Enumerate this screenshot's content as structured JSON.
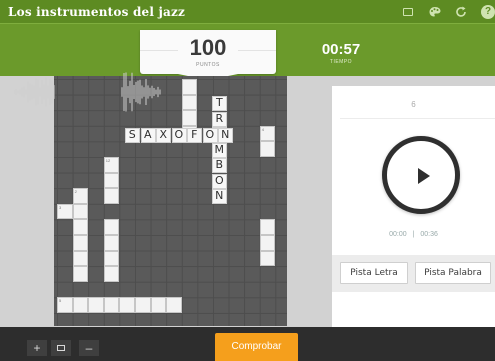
{
  "header": {
    "title": "Los instrumentos del jazz",
    "tools": [
      {
        "name": "keyboard-icon"
      },
      {
        "name": "palette-icon"
      },
      {
        "name": "refresh-icon"
      },
      {
        "name": "help-icon",
        "glyph": "?"
      }
    ]
  },
  "score": {
    "value": "100",
    "label": "PUNTOS"
  },
  "timer": {
    "value": "00:57",
    "label": "TIEMPO"
  },
  "board": {
    "words": [
      {
        "word": "TROMBON",
        "direction": "down"
      },
      {
        "word": "SAXOFON",
        "direction": "across"
      }
    ],
    "cells": [
      {
        "n": "",
        "r": 0,
        "c": 8
      },
      {
        "n": "",
        "r": 1,
        "c": 8
      },
      {
        "n": "",
        "r": 2,
        "c": 8
      },
      {
        "n": "",
        "r": 3,
        "c": 8
      },
      {
        "n": "4",
        "r": 3,
        "c": 13
      },
      {
        "n": "",
        "r": 4,
        "c": 13
      },
      {
        "n": "12",
        "r": 5,
        "c": 3
      },
      {
        "n": "",
        "r": 6,
        "c": 3
      },
      {
        "n": "",
        "r": 7,
        "c": 3
      },
      {
        "n": "2",
        "r": 7,
        "c": 1
      },
      {
        "n": "",
        "r": 8,
        "c": 1
      },
      {
        "n": "3",
        "r": 8,
        "c": 0
      },
      {
        "n": "",
        "r": 9,
        "c": 1
      },
      {
        "n": "",
        "r": 10,
        "c": 1
      },
      {
        "n": "",
        "r": 11,
        "c": 1
      },
      {
        "n": "",
        "r": 12,
        "c": 1
      },
      {
        "n": "",
        "r": 9,
        "c": 3
      },
      {
        "n": "",
        "r": 10,
        "c": 3
      },
      {
        "n": "",
        "r": 11,
        "c": 3
      },
      {
        "n": "",
        "r": 12,
        "c": 3
      },
      {
        "n": "",
        "r": 9,
        "c": 13
      },
      {
        "n": "",
        "r": 10,
        "c": 13
      },
      {
        "n": "",
        "r": 11,
        "c": 13
      },
      {
        "n": "5",
        "r": 14,
        "c": 0
      },
      {
        "n": "",
        "r": 14,
        "c": 1
      },
      {
        "n": "",
        "r": 14,
        "c": 2
      },
      {
        "n": "",
        "r": 14,
        "c": 3
      },
      {
        "n": "",
        "r": 14,
        "c": 4
      },
      {
        "n": "",
        "r": 14,
        "c": 5
      },
      {
        "n": "",
        "r": 14,
        "c": 6
      },
      {
        "n": "",
        "r": 14,
        "c": 7
      }
    ]
  },
  "clue": {
    "number": "6",
    "audio": {
      "current": "00:00",
      "separator": "|",
      "total": "00:36"
    }
  },
  "hints": {
    "letter": "Pista Letra",
    "word": "Pista Palabra"
  },
  "footer": {
    "zoom_in": "+",
    "zoom_out": "–",
    "check": "Comprobar"
  }
}
